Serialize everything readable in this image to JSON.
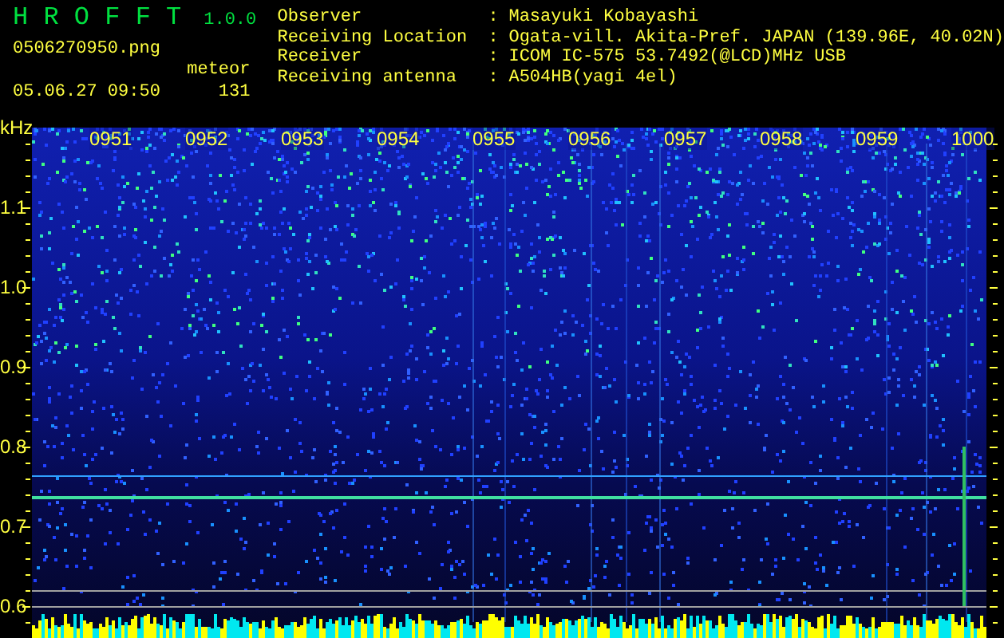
{
  "app": {
    "name": "H R O F F T",
    "version": "1.0.0",
    "file": "0506270950.png",
    "datetime": "05.06.27 09:50",
    "counter_label": "meteor",
    "counter_value": "131"
  },
  "station_info": [
    {
      "label": "Observer",
      "separator": ":",
      "value": "Masayuki Kobayashi"
    },
    {
      "label": "Receiving Location",
      "separator": ":",
      "value": "Ogata-vill. Akita-Pref. JAPAN (139.96E, 40.02N)"
    },
    {
      "label": "Receiver",
      "separator": ":",
      "value": "ICOM IC-575 53.7492(@LCD)MHz USB"
    },
    {
      "label": "Receiving antenna",
      "separator": ":",
      "value": "A504HB(yagi 4el)"
    }
  ],
  "frequency_axis": [
    "kHz",
    "1.1",
    "1.0",
    "0.9",
    "0.8",
    "0.7",
    "0.6"
  ],
  "time_labels": [
    "0951",
    "0952",
    "0953",
    "0954",
    "0955",
    "0956",
    "0957",
    "0958",
    "0959",
    "1000"
  ]
}
